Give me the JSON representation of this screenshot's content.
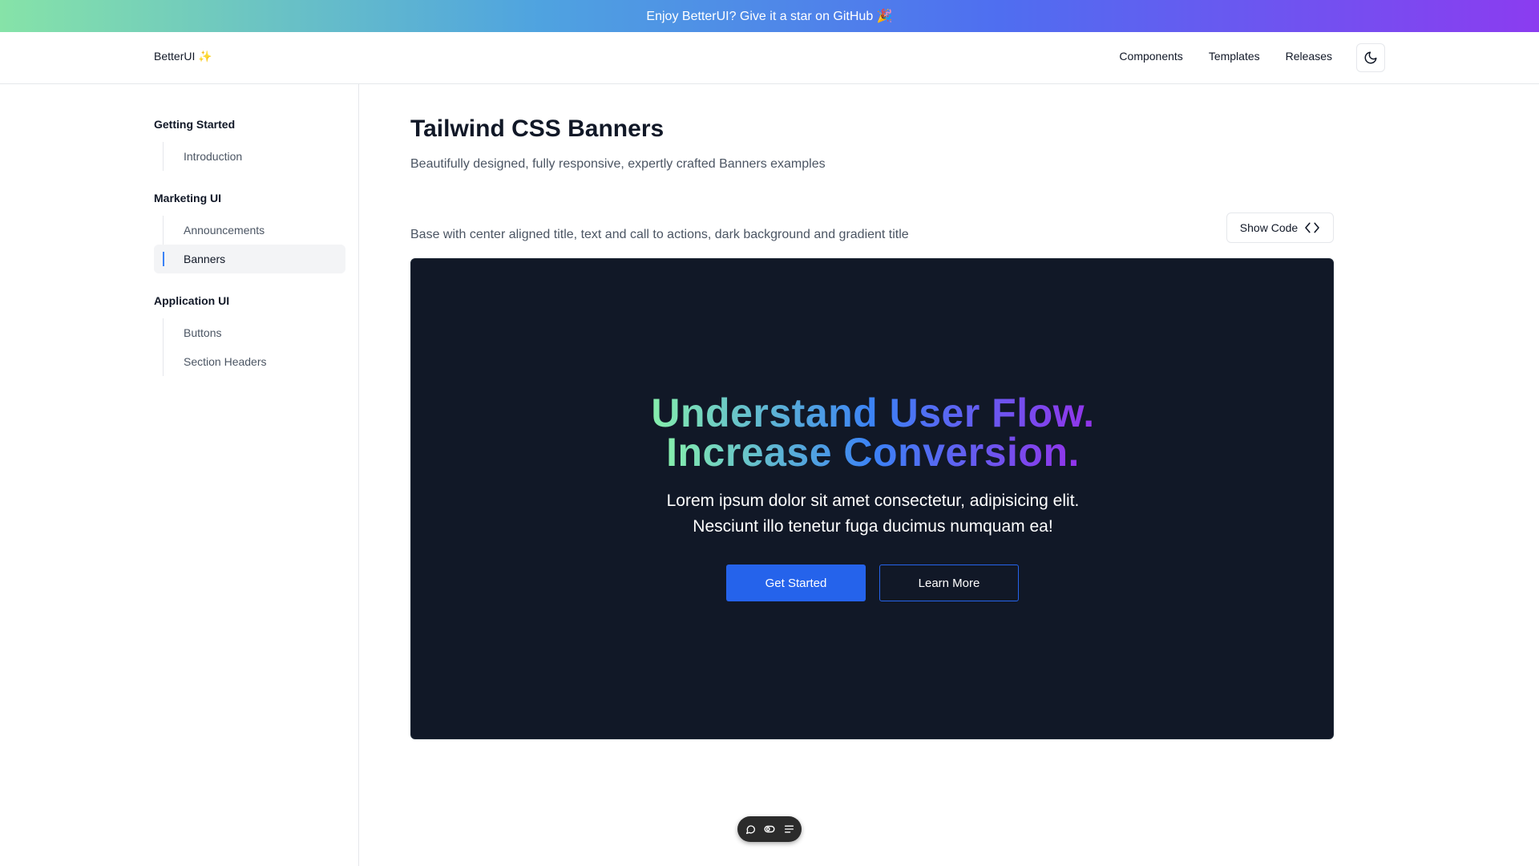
{
  "promo": {
    "text": "Enjoy BetterUI? Give it a star on GitHub 🎉"
  },
  "nav": {
    "brand": "BetterUI ✨",
    "links": [
      "Components",
      "Templates",
      "Releases"
    ],
    "theme_icon": "moon-icon"
  },
  "sidebar": {
    "groups": [
      {
        "title": "Getting Started",
        "items": [
          "Introduction"
        ]
      },
      {
        "title": "Marketing UI",
        "items": [
          "Announcements",
          "Banners"
        ]
      },
      {
        "title": "Application UI",
        "items": [
          "Buttons",
          "Section Headers"
        ]
      }
    ],
    "active_item": "Banners"
  },
  "page": {
    "title": "Tailwind CSS Banners",
    "subtitle": "Beautifully designed, fully responsive, expertly crafted Banners examples"
  },
  "example": {
    "description": "Base with center aligned title, text and call to actions, dark background and gradient title",
    "show_code_label": "Show Code",
    "show_code_icon": "code-brackets-icon"
  },
  "banner": {
    "headline_line1": "Understand User Flow.",
    "headline_line2": "Increase Conversion.",
    "body_line1": "Lorem ipsum dolor sit amet consectetur, adipisicing elit.",
    "body_line2": "Nesciunt illo tenetur fuga ducimus numquam ea!",
    "primary_cta": "Get Started",
    "secondary_cta": "Learn More",
    "background_color": "#111827",
    "gradient_colors": [
      "#86efac",
      "#3b82f6",
      "#9333ea"
    ],
    "primary_color": "#2563eb"
  },
  "toolbar": {
    "icons": [
      "comment-icon",
      "toggle-icon",
      "menu-icon"
    ]
  }
}
